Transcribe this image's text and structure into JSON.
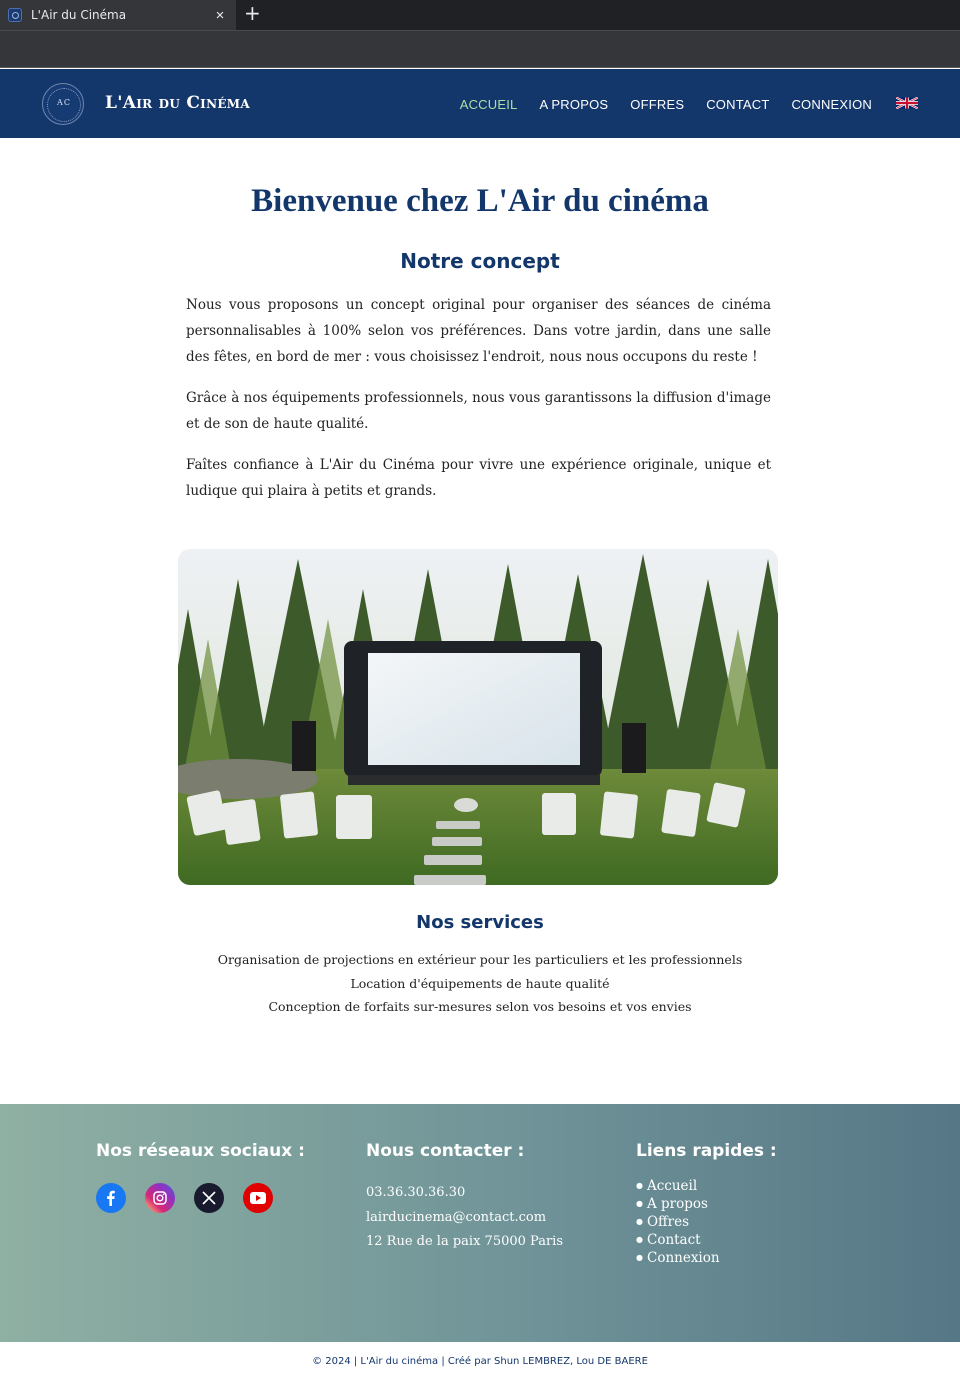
{
  "browser": {
    "tab_title": "L'Air du Cinéma",
    "close_glyph": "×",
    "new_tab_glyph": "+"
  },
  "header": {
    "logo_monogram": "AC",
    "site_name": "L'Air du Cinéma",
    "nav": [
      {
        "label": "ACCUEIL",
        "active": true
      },
      {
        "label": "A PROPOS"
      },
      {
        "label": "OFFRES"
      },
      {
        "label": "CONTACT"
      },
      {
        "label": "CONNEXION"
      }
    ],
    "language_flag": "uk-flag-icon"
  },
  "main": {
    "title": "Bienvenue chez L'Air du cinéma",
    "concept_title": "Notre concept",
    "concept_paragraphs": [
      "Nous vous proposons un concept original pour organiser des séances de cinéma personnalisables à 100% selon vos préférences. Dans votre jardin, dans une salle des fêtes, en bord de mer : vous choisissez l'endroit, nous nous occupons du reste !",
      "Grâce à nos équipements professionnels, nous vous garantissons la diffusion d'image et de son de haute qualité.",
      "Faîtes confiance à L'Air du Cinéma pour vivre une expérience originale, unique et ludique qui plaira à petits et grands."
    ],
    "hero_image": "outdoor-cinema-screen-image",
    "services_title": "Nos services",
    "services": [
      "Organisation de projections en extérieur pour les particuliers et les professionnels",
      "Location d'équipements de haute qualité",
      "Conception de forfaits sur-mesures selon vos besoins et vos envies"
    ]
  },
  "footer": {
    "social_title": "Nos réseaux sociaux :",
    "socials": [
      {
        "name": "facebook-icon",
        "color": "#1877f2"
      },
      {
        "name": "instagram-icon",
        "color": "#e1306c"
      },
      {
        "name": "x-icon",
        "color": "#1a1a2e"
      },
      {
        "name": "youtube-icon",
        "color": "#e00000"
      }
    ],
    "contact_title": "Nous contacter :",
    "phone": "03.36.30.36.30",
    "email": "lairducinema@contact.com",
    "address": "12 Rue de la paix 75000 Paris",
    "links_title": "Liens rapides :",
    "links": [
      "Accueil",
      "A propos",
      "Offres",
      "Contact",
      "Connexion"
    ],
    "copyright": "© 2024 | L'Air du cinéma | Créé par Shun LEMBREZ, Lou DE BAERE"
  },
  "colors": {
    "primary": "#13366b",
    "nav_active": "#a8e0a8",
    "footer_gradient_start": "#8fb0a3",
    "footer_gradient_end": "#567786"
  }
}
